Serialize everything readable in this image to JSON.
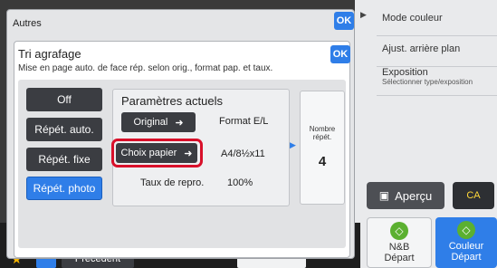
{
  "right_panel": {
    "items": [
      {
        "label": "Mode couleur",
        "sub": ""
      },
      {
        "label": "Ajust. arrière plan",
        "sub": ""
      },
      {
        "label": "Exposition",
        "sub": "Sélectionner type/exposition"
      }
    ],
    "preview_label": "Aperçu",
    "ca_label": "CA",
    "nb_line1": "N&B",
    "nb_line2": "Départ",
    "couleur_line1": "Couleur",
    "couleur_line2": "Départ"
  },
  "bottom": {
    "prev_label": "Précédent"
  },
  "outer_dialog": {
    "title": "Autres",
    "ok_label": "OK"
  },
  "inner_dialog": {
    "title": "Tri agrafage",
    "subtitle": "Mise en page auto. de face rép. selon orig., format pap. et taux.",
    "ok_label": "OK",
    "modes": [
      "Off",
      "Répét. auto.",
      "Répét. fixe",
      "Répét. photo"
    ],
    "selected_mode": "Répét. photo",
    "params": {
      "title": "Paramètres actuels",
      "original_btn": "Original",
      "original_value": "Format E/L",
      "paper_btn": "Choix papier",
      "paper_value": "A4/8½x11",
      "ratio_label": "Taux de repro.",
      "ratio_value": "100%"
    },
    "count": {
      "label_line1": "Nombre",
      "label_line2": "répét.",
      "value": "4"
    }
  },
  "colors": {
    "accent_blue": "#2f7ee8",
    "highlight_red": "#d8102a"
  }
}
